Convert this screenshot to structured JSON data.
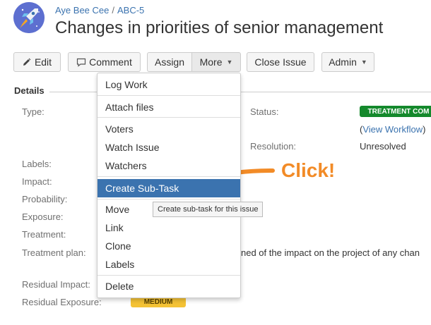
{
  "header": {
    "project_name": "Aye Bee Cee",
    "separator": "/",
    "issue_key": "ABC-5",
    "title": "Changes in priorities of senior management"
  },
  "toolbar": {
    "edit": "Edit",
    "comment": "Comment",
    "assign": "Assign",
    "more": "More",
    "close_issue": "Close Issue",
    "admin": "Admin"
  },
  "details": {
    "heading": "Details",
    "fields": {
      "type": "Type:",
      "labels": "Labels:",
      "impact": "Impact:",
      "probability": "Probability:",
      "exposure": "Exposure:",
      "treatment": "Treatment:",
      "treatment_plan": "Treatment plan:",
      "residual_impact": "Residual Impact:",
      "residual_exposure": "Residual Exposure:"
    },
    "status_label": "Status:",
    "status_value": "TREATMENT COM",
    "view_workflow_prefix": "(",
    "view_workflow": "View Workflow",
    "view_workflow_suffix": ")",
    "resolution_label": "Resolution:",
    "resolution_value": "Unresolved",
    "treatment_plan_value": "ned of the impact on the project of any chan",
    "residual_exposure_value": "MEDIUM"
  },
  "more_menu": {
    "items": [
      "Log Work",
      "Attach files",
      "Voters",
      "Watch Issue",
      "Watchers",
      "Create Sub-Task",
      "Move",
      "Link",
      "Clone",
      "Labels",
      "Delete"
    ]
  },
  "tooltip": "Create sub-task for this issue",
  "annotation": "Click!",
  "colors": {
    "link": "#3b73af",
    "highlight": "#3b73af",
    "status_green": "#14892c",
    "medium_yellow": "#f4c235",
    "annotation_orange": "#f28b27"
  }
}
